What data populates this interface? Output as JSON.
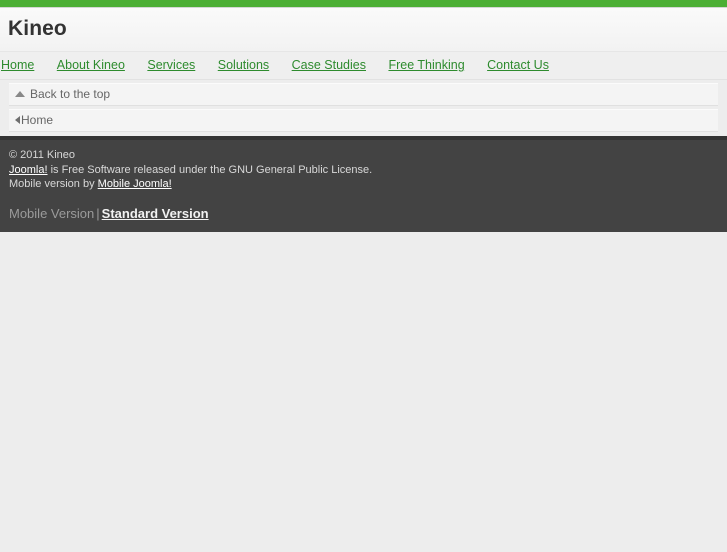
{
  "site": {
    "title": "Kineo",
    "accent_green": "#4caf35",
    "link_green": "#2e8b2e",
    "footer_bg": "#434343"
  },
  "nav": {
    "items": [
      {
        "label": "Home"
      },
      {
        "label": "About Kineo"
      },
      {
        "label": "Services"
      },
      {
        "label": "Solutions"
      },
      {
        "label": "Case Studies"
      },
      {
        "label": "Free Thinking"
      },
      {
        "label": "Contact Us"
      }
    ]
  },
  "panels": {
    "back_to_top": {
      "label": "Back to the top",
      "icon": "triangle-up-icon"
    },
    "breadcrumb": {
      "label": "Home",
      "icon": "triangle-left-icon"
    }
  },
  "footer": {
    "copyright": "© 2011 Kineo",
    "license_link": "Joomla!",
    "license_text": " is Free Software released under the GNU General Public License.",
    "mobile_by_prefix": "Mobile version by ",
    "mobile_by_link": "Mobile Joomla!",
    "version_current": "Mobile Version",
    "version_separator": "|",
    "version_other": "Standard Version"
  }
}
